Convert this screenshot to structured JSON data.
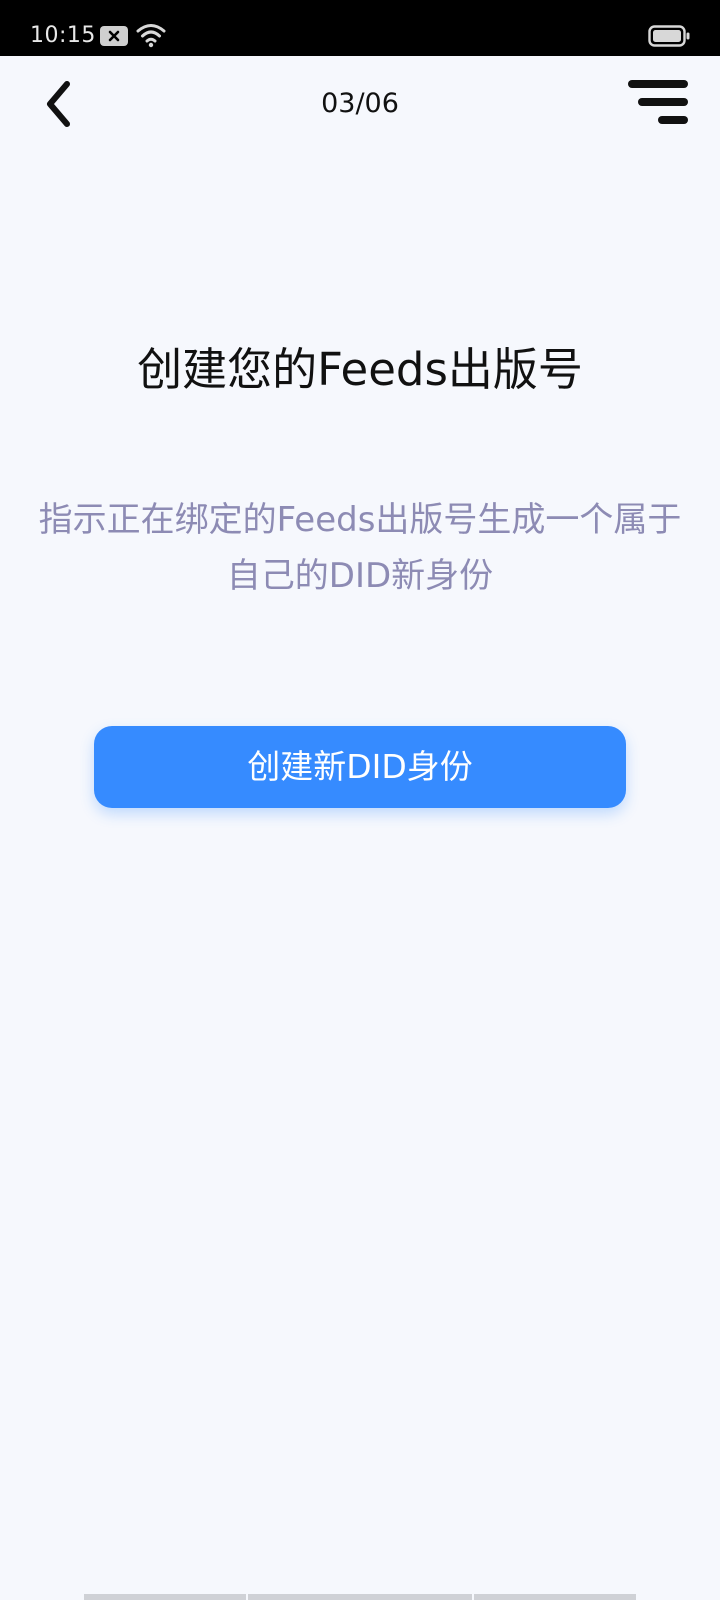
{
  "status_bar": {
    "time": "10:15",
    "icons": [
      "notification-icon",
      "wifi-icon",
      "battery-icon"
    ]
  },
  "header": {
    "back_icon": "chevron-left-icon",
    "counter": "03/06",
    "menu_icon": "menu-icon"
  },
  "main": {
    "title": "创建您的Feeds出版号",
    "description": "指示正在绑定的Feeds出版号生成一个属于自己的DID新身份",
    "button_label": "创建新DID身份"
  },
  "colors": {
    "background": "#f6f8fd",
    "accent": "#368bff",
    "description_text": "#8d8bb4",
    "title_text": "#111111"
  }
}
